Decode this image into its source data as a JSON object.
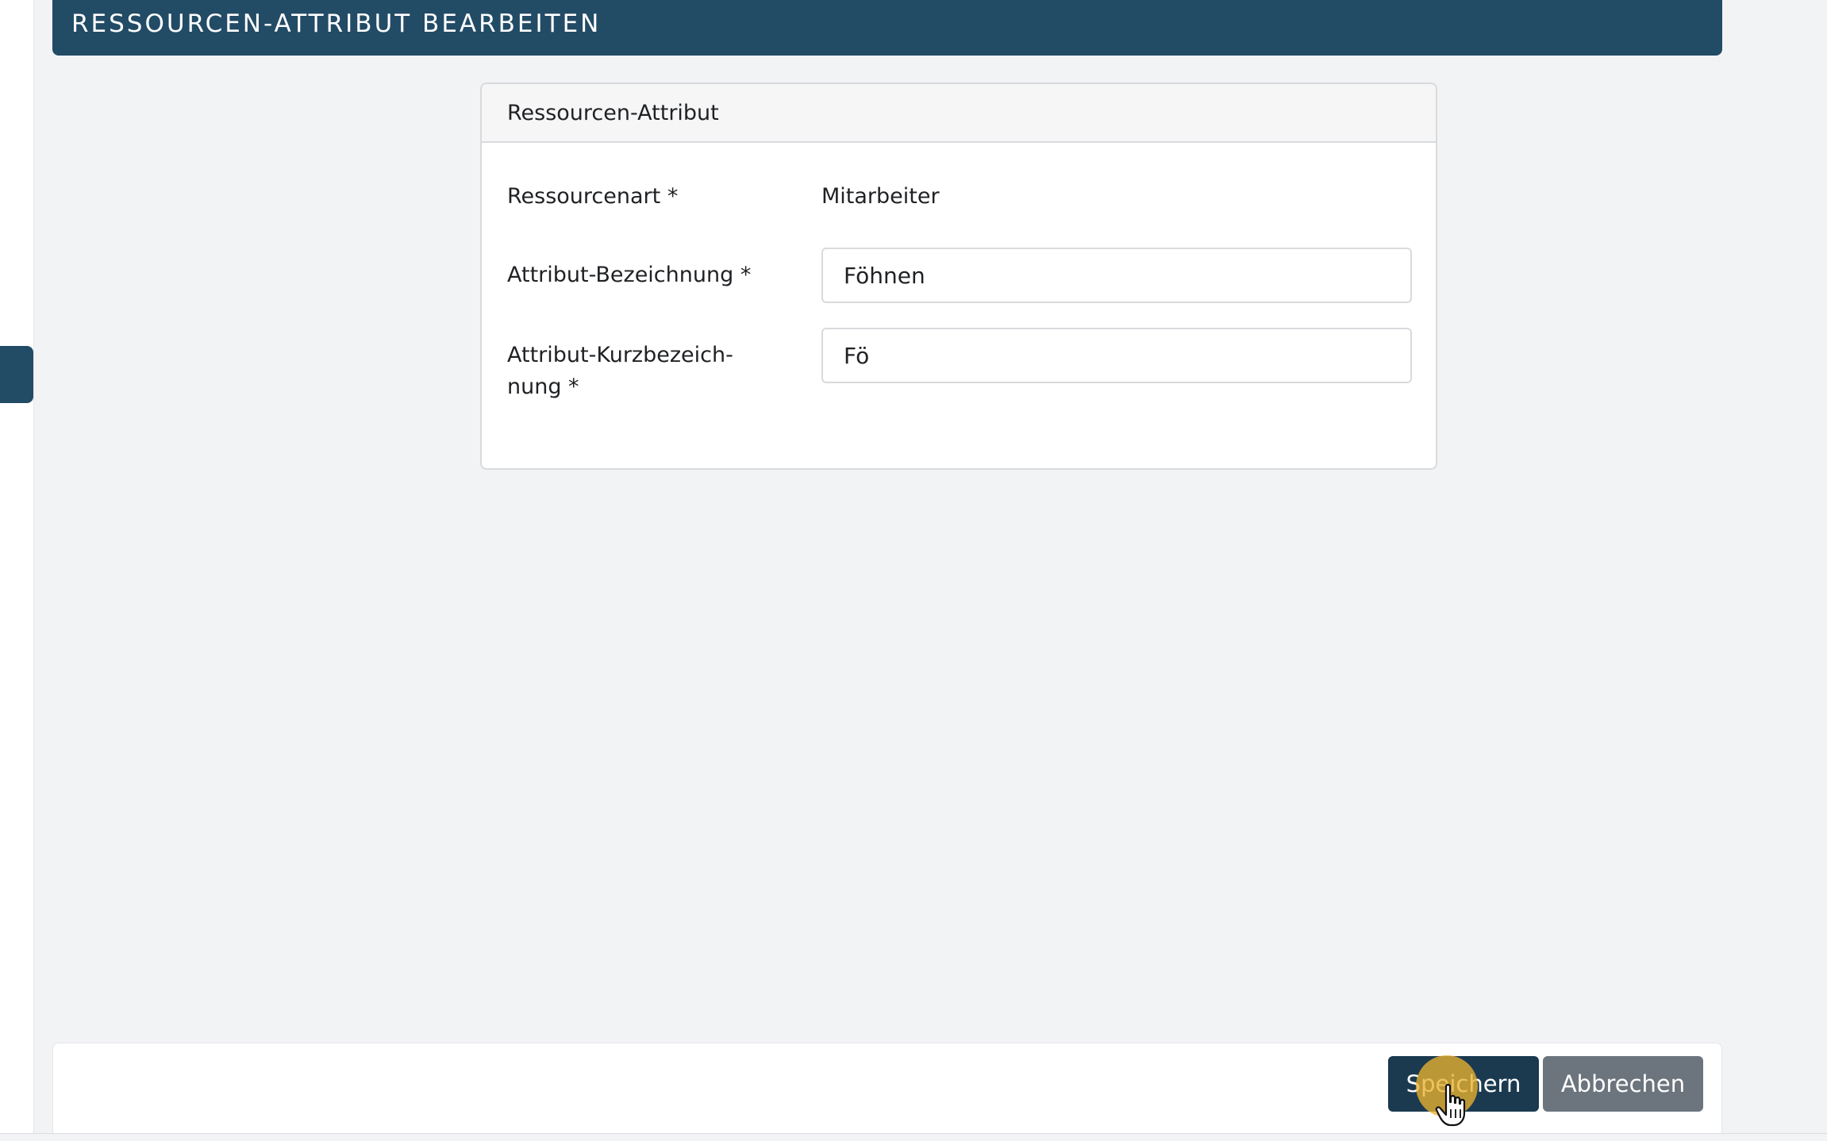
{
  "header": {
    "title": "RESSOURCEN-ATTRIBUT BEARBEITEN"
  },
  "card": {
    "title": "Ressourcen-Attribut",
    "fields": [
      {
        "label": "Ressourcenart *",
        "value": "Mitarbeiter"
      },
      {
        "label": "Attribut-Bezeichnung *",
        "value": "Föhnen"
      },
      {
        "label": "Attribut-Kurzbezeich-\nnung *",
        "value": "Fö"
      }
    ]
  },
  "footer": {
    "save_label": "Speichern",
    "cancel_label": "Abbrechen"
  },
  "colors": {
    "primary": "#224b66",
    "save_button": "#1b3a50",
    "cancel_button": "#6c757d",
    "click_highlight": "#e9b22e"
  },
  "icons": {
    "cursor": "hand-pointer-icon"
  }
}
